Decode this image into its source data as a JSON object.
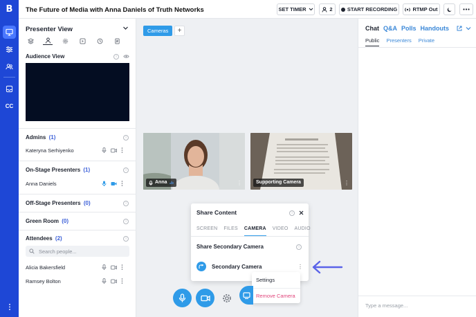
{
  "app": {
    "title": "The Future of Media with Anna Daniels of Truth Networks",
    "logo_letter": "B"
  },
  "colors": {
    "rail": "#1e47d6",
    "accent": "#2f9be8",
    "count": "#3b5fd8",
    "danger": "#e0447a",
    "arrow": "#5a63e8"
  },
  "header": {
    "set_timer": "SET TIMER",
    "attendee_count": "2",
    "start_recording": "START RECORDING",
    "rtmp": "RTMP Out"
  },
  "rail": {
    "cc": "CC",
    "icons": [
      "presenter-view-icon",
      "sliders-icon",
      "people-icon",
      "inbox-icon",
      "captions-icon",
      "more-icon"
    ]
  },
  "presenter": {
    "title": "Presenter View",
    "audience_view": "Audience View",
    "sections": {
      "admins": {
        "label": "Admins",
        "count": "(1)",
        "people": [
          "Kateryna Serhiyenko"
        ]
      },
      "on_stage": {
        "label": "On-Stage Presenters",
        "count": "(1)",
        "people": [
          "Anna Daniels"
        ]
      },
      "off_stage": {
        "label": "Off-Stage Presenters",
        "count": "(0)"
      },
      "green_room": {
        "label": "Green Room",
        "count": "(0)"
      },
      "attendees": {
        "label": "Attendees",
        "count": "(2)",
        "people": [
          "Alicia Bakersfield",
          "Ramsey Bolton"
        ]
      }
    },
    "search_placeholder": "Search people..."
  },
  "stage": {
    "tab": "Cameras",
    "add": "+",
    "tiles": [
      {
        "label": "Anna"
      },
      {
        "label": "Supporting Camera"
      }
    ]
  },
  "share": {
    "title": "Share Content",
    "tabs": [
      "SCREEN",
      "FILES",
      "CAMERA",
      "VIDEO",
      "AUDIO"
    ],
    "active_tab": "CAMERA",
    "subtitle": "Share Secondary Camera",
    "camera_name": "Secondary Camera",
    "menu": {
      "settings": "Settings",
      "remove": "Remove Camera"
    }
  },
  "chat": {
    "tabs": [
      "Chat",
      "Q&A",
      "Polls",
      "Handouts"
    ],
    "sub_tabs": [
      "Public",
      "Presenters",
      "Private"
    ],
    "placeholder": "Type a message..."
  }
}
